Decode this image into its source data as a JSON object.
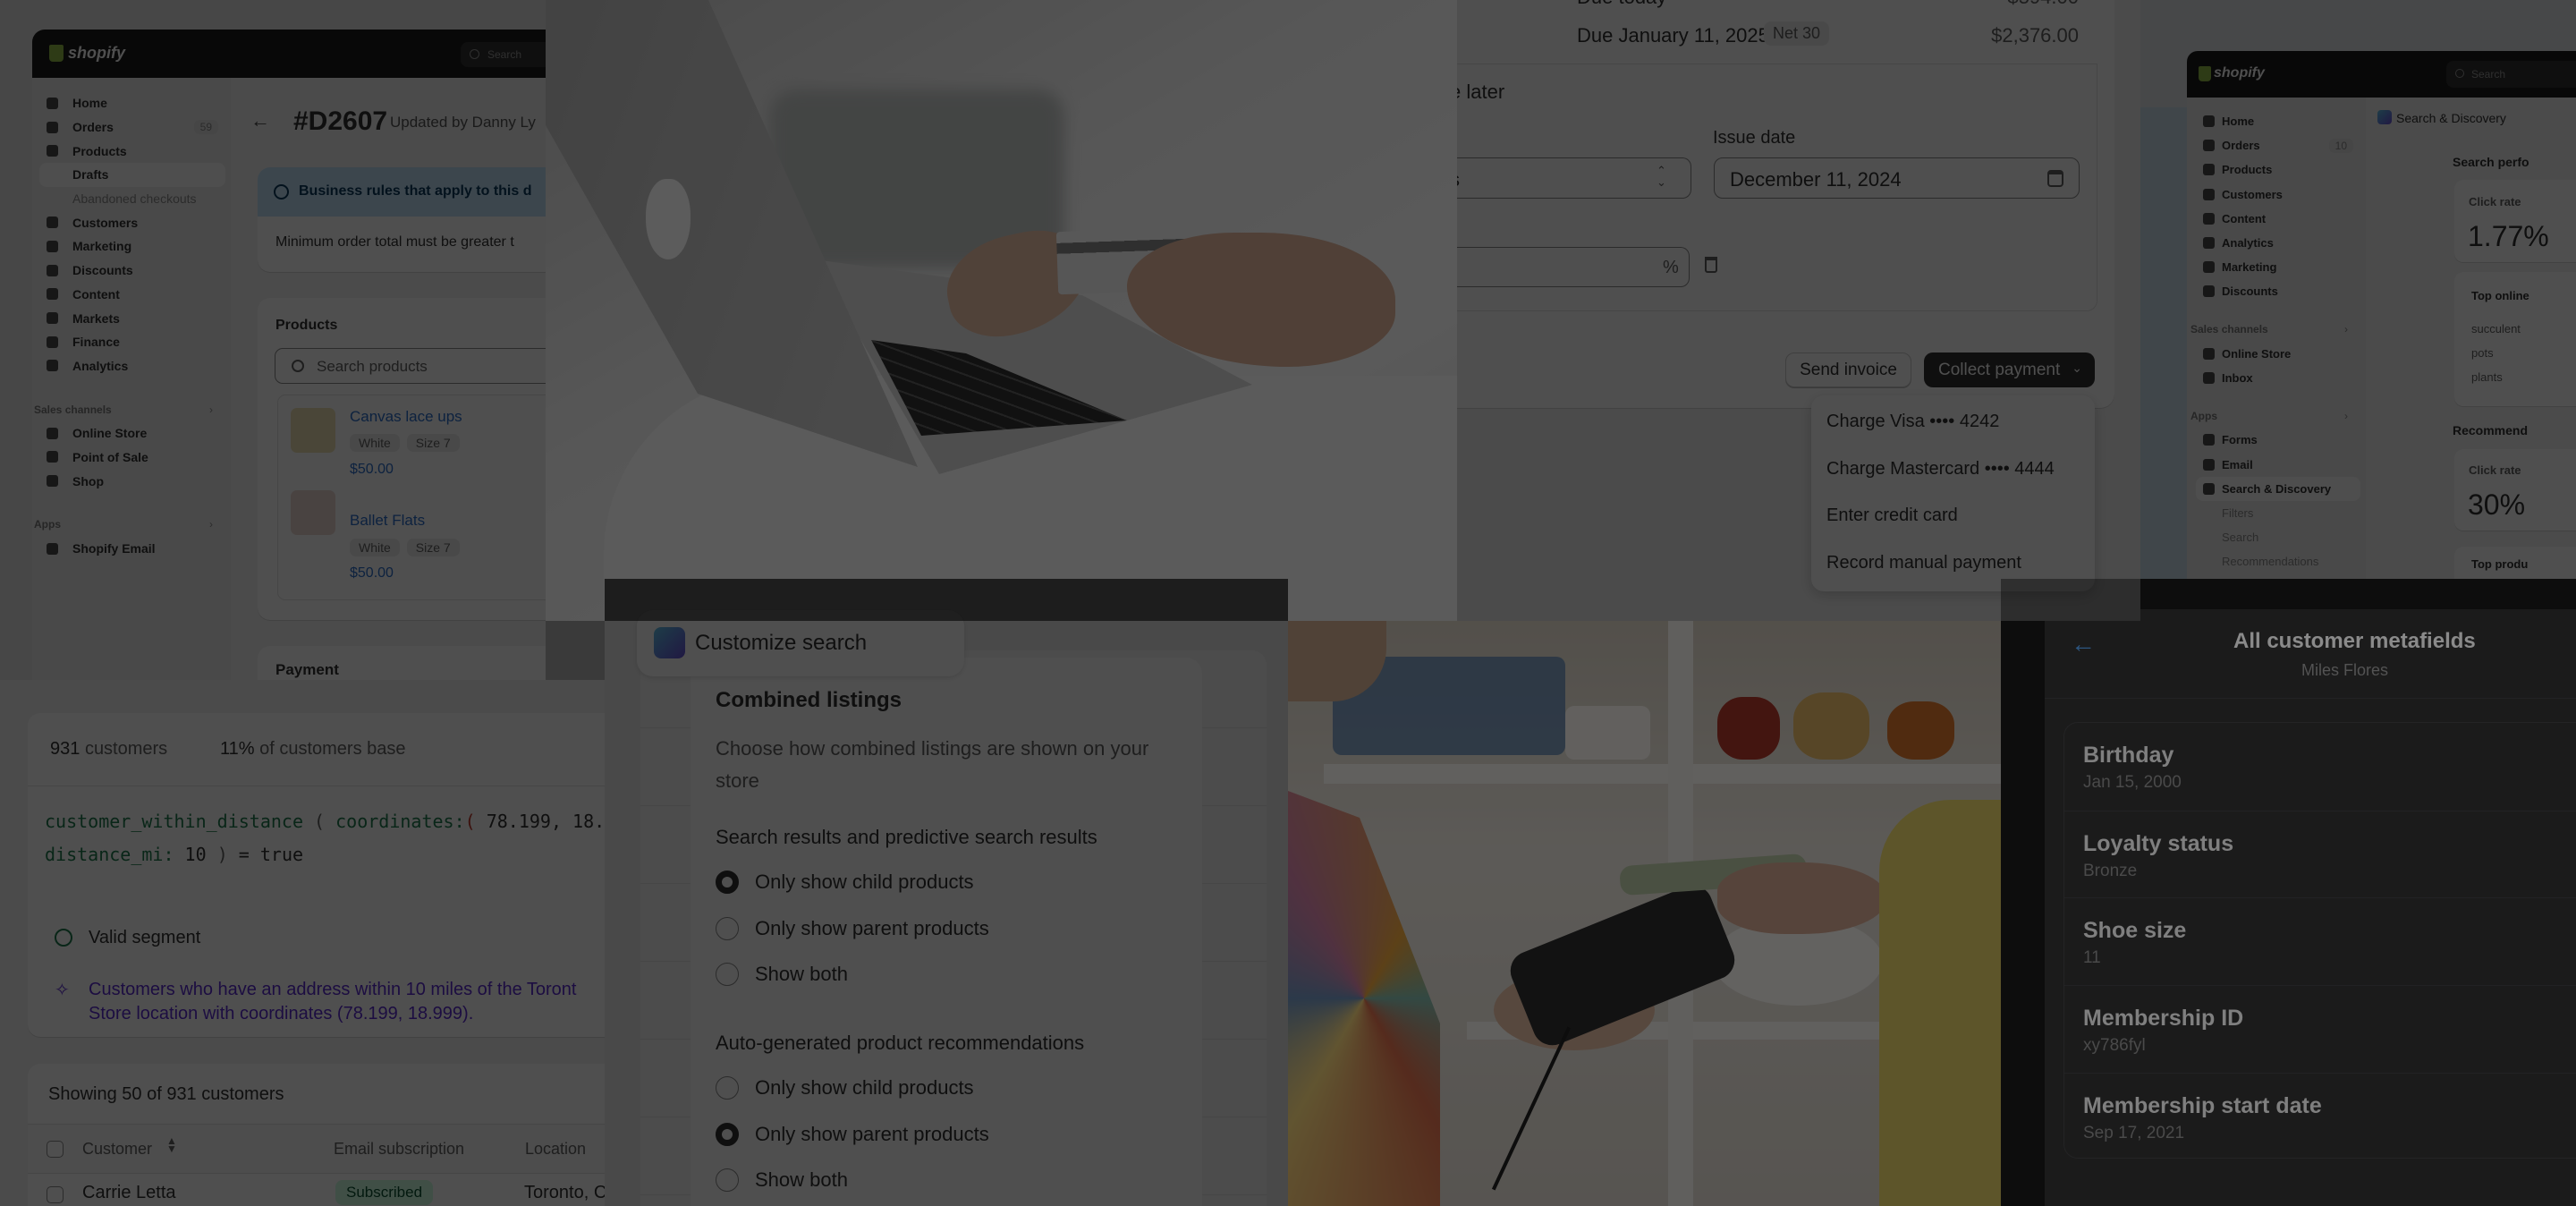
{
  "colors": {
    "accent_blue": "#2c6ecb",
    "primary_button": "#303030",
    "success": "#1f7a4d",
    "magic_purple": "#5b2bd1",
    "metafield_link": "#4a8fd6",
    "banner_info": "#c3e2f7"
  },
  "draft_order": {
    "brand": "shopify",
    "search": "Search",
    "nav": [
      {
        "label": "Home",
        "icon": "home-icon"
      },
      {
        "label": "Orders",
        "icon": "orders-icon",
        "badge": "59"
      },
      {
        "label": "Products",
        "icon": "tag-icon"
      },
      {
        "label": "Drafts",
        "sub": true,
        "active": true
      },
      {
        "label": "Abandoned checkouts",
        "sub": true,
        "muted": true
      },
      {
        "label": "Customers",
        "icon": "person-icon"
      },
      {
        "label": "Marketing",
        "icon": "marketing-icon"
      },
      {
        "label": "Discounts",
        "icon": "discount-icon"
      },
      {
        "label": "Content",
        "icon": "content-icon"
      },
      {
        "label": "Markets",
        "icon": "globe-icon"
      },
      {
        "label": "Finance",
        "icon": "bank-icon"
      },
      {
        "label": "Analytics",
        "icon": "bar-chart-icon"
      },
      {
        "section": "Sales channels"
      },
      {
        "label": "Online Store",
        "icon": "store-icon"
      },
      {
        "label": "Point of Sale",
        "icon": "pos-icon"
      },
      {
        "label": "Shop",
        "icon": "shop-icon"
      },
      {
        "section": "Apps"
      },
      {
        "label": "Shopify Email",
        "icon": "email-icon"
      }
    ],
    "title": "#D2607",
    "updated": "Updated by Danny Ly",
    "banner_title": "Business rules that apply to this d",
    "banner_body": "Minimum order total must be greater t",
    "products_title": "Products",
    "search_placeholder": "Search products",
    "products": [
      {
        "name": "Canvas lace ups",
        "variants": [
          "White",
          "Size 7"
        ],
        "price": "$50.00"
      },
      {
        "name": "Ballet Flats",
        "variants": [
          "White",
          "Size 7"
        ],
        "price": "$50.00"
      }
    ],
    "payment_title": "Payment"
  },
  "payment": {
    "due_today_label": "Due today",
    "due_today_amount": "$594.00",
    "due_later_label": "Due January 11, 2025",
    "terms_badge": "Net 30",
    "due_later_amount": "$2,376.00",
    "pay_later_label": "e later",
    "terms_select_value": "s",
    "issue_date_label": "Issue date",
    "issue_date_value": "December 11, 2024",
    "percent_suffix": "%",
    "send_invoice": "Send invoice",
    "collect_payment": "Collect payment",
    "menu": [
      "Charge Visa •••• 4242",
      "Charge Mastercard •••• 4444",
      "Enter credit card",
      "Record manual payment"
    ]
  },
  "search_discovery": {
    "brand": "shopify",
    "search": "Search",
    "nav": [
      {
        "label": "Home",
        "icon": "home-icon"
      },
      {
        "label": "Orders",
        "icon": "orders-icon",
        "badge": "10"
      },
      {
        "label": "Products",
        "icon": "tag-icon"
      },
      {
        "label": "Customers",
        "icon": "person-icon"
      },
      {
        "label": "Content",
        "icon": "content-icon"
      },
      {
        "label": "Analytics",
        "icon": "bar-chart-icon"
      },
      {
        "label": "Marketing",
        "icon": "marketing-icon"
      },
      {
        "label": "Discounts",
        "icon": "discount-icon"
      },
      {
        "section": "Sales channels"
      },
      {
        "label": "Online Store",
        "icon": "store-icon"
      },
      {
        "label": "Inbox",
        "icon": "inbox-icon"
      },
      {
        "section": "Apps"
      },
      {
        "label": "Forms",
        "icon": "forms-icon"
      },
      {
        "label": "Email",
        "icon": "email-icon"
      },
      {
        "label": "Search & Discovery",
        "icon": "search-app-icon",
        "active": true
      },
      {
        "label": "Filters",
        "sub": true,
        "muted": true
      },
      {
        "label": "Search",
        "sub": true,
        "muted": true
      },
      {
        "label": "Recommendations",
        "sub": true,
        "muted": true
      }
    ],
    "app_title": "Search & Discovery",
    "search_perf_heading": "Search perfo",
    "click_rate_label": "Click rate",
    "click_rate_value": "1.77%",
    "top_online_heading": "Top online",
    "top_terms": [
      "succulent",
      "pots",
      "plants"
    ],
    "recommend_heading": "Recommend",
    "rec_click_rate_label": "Click rate",
    "rec_click_rate_value": "30%",
    "top_products_heading": "Top produ"
  },
  "segment": {
    "count": "931",
    "count_label": "customers",
    "pct": "11%",
    "pct_label": "of customers base",
    "code": {
      "fn": "customer_within_distance",
      "p1": "(",
      "arg1": "coordinates:",
      "p2": "(",
      "coords": "78.199, 18.9",
      "arg2": "distance_mi:",
      "val": "10",
      "close": ")",
      "eq": "= true"
    },
    "valid": "Valid segment",
    "desc_line1": "Customers who have an address within 10 miles of the Toront",
    "desc_line2": "Store location with coordinates (78.199, 18.999).",
    "showing": "Showing 50 of 931 customers",
    "columns": [
      "Customer",
      "Email subscription",
      "Location"
    ],
    "rows": [
      {
        "name": "Carrie Letta",
        "subscription": "Subscribed",
        "location": "Toronto, C"
      }
    ]
  },
  "customize_search": {
    "app_label": "Customize search",
    "title": "Combined listings",
    "description": "Choose how combined listings are shown on your store",
    "groups": [
      {
        "label": "Search results and predictive search results",
        "options": [
          "Only show child products",
          "Only show parent products",
          "Show both"
        ],
        "selected": 0
      },
      {
        "label": "Auto-generated product recommendations",
        "options": [
          "Only show child products",
          "Only show parent products",
          "Show both"
        ],
        "selected": 1
      }
    ]
  },
  "metafields": {
    "title": "All customer metafields",
    "subtitle": "Miles Flores",
    "fields": [
      {
        "label": "Birthday",
        "value": "Jan 15, 2000"
      },
      {
        "label": "Loyalty status",
        "value": "Bronze"
      },
      {
        "label": "Shoe size",
        "value": "11"
      },
      {
        "label": "Membership ID",
        "value": "xy786fyl"
      },
      {
        "label": "Membership start date",
        "value": "Sep 17, 2021"
      }
    ]
  }
}
